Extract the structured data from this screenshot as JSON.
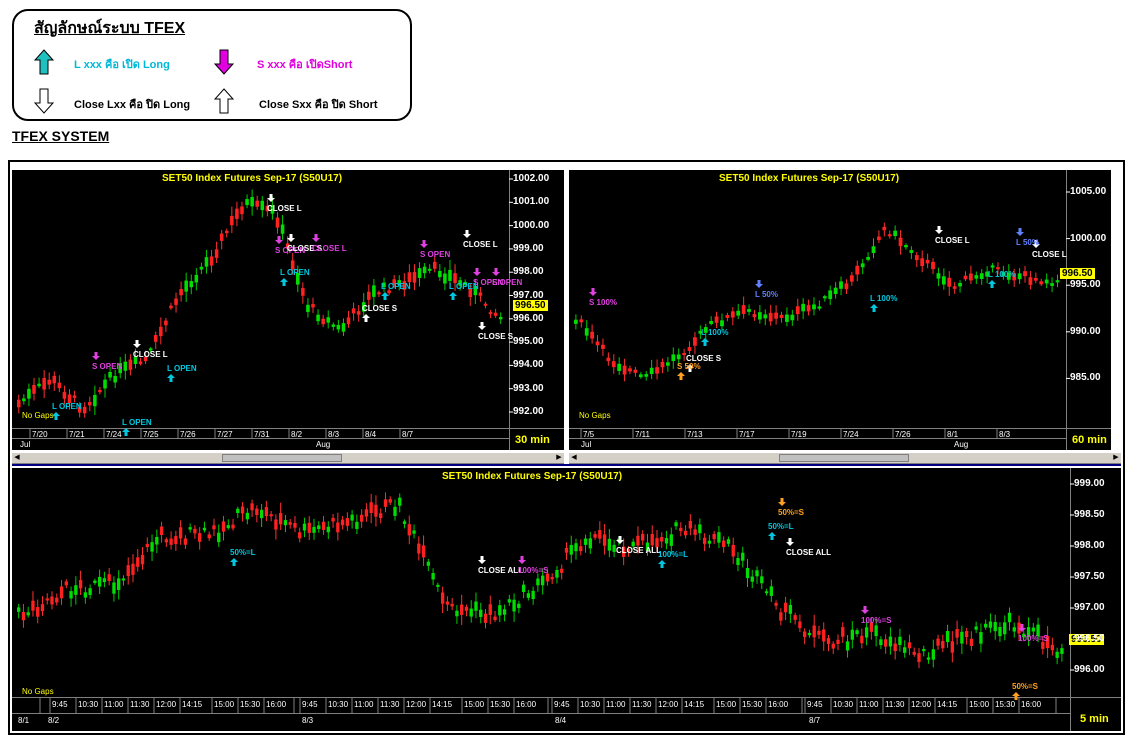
{
  "legend": {
    "title": "สัญลักษณ์ระบบ TFEX",
    "long_open": "L xxx คือ เปิด Long",
    "short_open": "S xxx คือ เปิดShort",
    "close_long": "Close Lxx คือ ปิด Long",
    "close_short": "Close Sxx คือ ปิด Short",
    "colors": {
      "long": "#00b8d8",
      "short": "#e000e0"
    }
  },
  "system_title": "TFEX SYSTEM",
  "panels": {
    "p30": {
      "title": "SET50  Index  Futures  Sep-17  (S50U17)",
      "no_gaps": "No Gaps",
      "timeframe": "30  min",
      "price": "996.50",
      "yticks": [
        "1002.00",
        "1001.00",
        "1000.00",
        "999.00",
        "998.00",
        "997.00",
        "996.00",
        "995.00",
        "994.00",
        "993.00",
        "992.00"
      ],
      "xdates": [
        "7/20",
        "7/21",
        "7/24",
        "7/25",
        "7/26",
        "7/27",
        "7/31",
        "8/2",
        "8/3",
        "8/4",
        "8/7"
      ],
      "xmonths": [
        "Jul",
        "Aug"
      ],
      "signals": [
        "S  OPEN",
        "L  OPEN",
        "CLOSE  L",
        "L  OPEN",
        "S  OPEN",
        "CLOSE  L",
        "CLOSE  S",
        "L  OPEN",
        "L  OPEN",
        "CLOSE  L",
        "CLOSE  S",
        "S  OPEN",
        "L  OPEN",
        "CLOSE  S",
        "S  OPEN",
        "CLOSE  L",
        "S  OPEN",
        "L  OPEN"
      ]
    },
    "p60": {
      "title": "SET50  Index  Futures  Sep-17  (S50U17)",
      "no_gaps": "No Gaps",
      "timeframe": "60  min",
      "price": "996.50",
      "yticks": [
        "1005.00",
        "1000.00",
        "995.00",
        "990.00",
        "985.00"
      ],
      "xdates": [
        "7/5",
        "7/11",
        "7/13",
        "7/17",
        "7/19",
        "7/24",
        "7/26",
        "8/1",
        "8/3"
      ],
      "xmonths": [
        "Jul",
        "Aug"
      ],
      "signals": [
        "S  100%",
        "L  100%",
        "CLOSE  S",
        "S  50%",
        "L  50%",
        "L  100%",
        "CLOSE  L",
        "L  100%",
        "L  50%",
        "CLOSE  L"
      ]
    },
    "p5": {
      "title": "SET50  Index  Futures  Sep-17  (S50U17)",
      "no_gaps": "No Gaps",
      "timeframe": "5  min",
      "price": "996.50",
      "yticks": [
        "999.00",
        "998.50",
        "998.00",
        "997.50",
        "997.00",
        "996.50",
        "996.00"
      ],
      "xtimes": [
        "9:45",
        "10:30",
        "11:00",
        "11:30",
        "12:00",
        "14:15",
        "15:00",
        "15:30",
        "16:00"
      ],
      "xdays": [
        "8/1",
        "8/2",
        "8/3",
        "8/4",
        "8/7"
      ],
      "signals": [
        "50%=L",
        "CLOSE  ALL",
        "100%=S",
        "CLOSE  ALL",
        "100%=L",
        "50%=L",
        "CLOSE  ALL",
        "50%=S",
        "100%=S",
        "100%=S",
        "50%=S"
      ]
    }
  }
}
